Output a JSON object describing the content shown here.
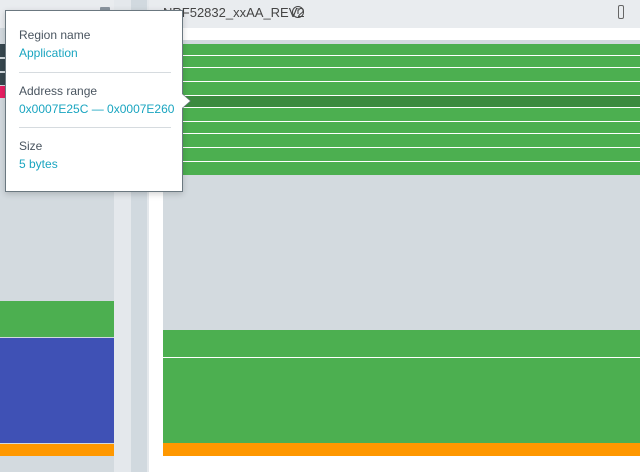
{
  "device": {
    "title": "NRF52832_xxAA_REV2",
    "info_icon": "info-circle-icon",
    "overflow_icon": "kebab-menu-icon"
  },
  "left_panel": {
    "header_icon": "folder-icon"
  },
  "tooltip": {
    "region_name_label": "Region name",
    "region_name_value": "Application",
    "address_range_label": "Address range",
    "address_range_value": "0x0007E25C — 0x0007E260",
    "size_label": "Size",
    "size_value": "5 bytes"
  },
  "colors": {
    "application_region": "#4caf50",
    "highlighted_region": "#3b8a3f",
    "bootloader_region": "#3f51b5",
    "mbr_region": "#ff9800",
    "settings_region": "#37474f",
    "uicr_region": "#e91e63",
    "empty_region": "#d3dadf",
    "tooltip_value": "#1aa5c0"
  }
}
